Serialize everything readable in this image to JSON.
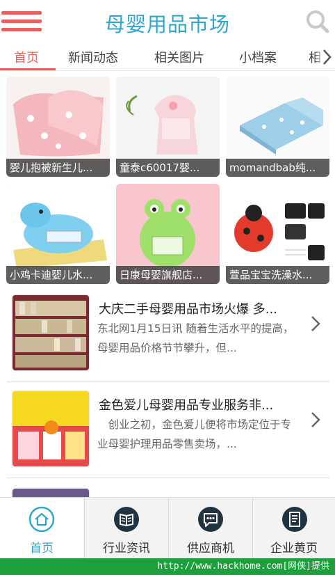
{
  "header": {
    "title": "母婴用品市场",
    "menu_icon": "hamburger-menu-icon",
    "search_icon": "search-icon"
  },
  "tabs": [
    {
      "label": "首页",
      "active": true
    },
    {
      "label": "新闻动态",
      "active": false
    },
    {
      "label": "相关图片",
      "active": false
    },
    {
      "label": "小档案",
      "active": false
    },
    {
      "label": "相",
      "active": false
    }
  ],
  "gallery": [
    {
      "caption": "婴儿抱被新生儿..."
    },
    {
      "caption": "童泰c60017婴..."
    },
    {
      "caption": "momandbab纯..."
    },
    {
      "caption": "小鸡卡迪婴儿水..."
    },
    {
      "caption": "日康母婴旗舰店..."
    },
    {
      "caption": "萱品宝宝洗澡水..."
    }
  ],
  "news": [
    {
      "title": "大庆二手母婴用品市场火爆 多...",
      "summary": "东北网1月15日讯 随着生活水平的提高，母婴用品价格节节攀升，但..."
    },
    {
      "title": "金色爱儿母婴用品专业服务非...",
      "summary": "　创业之初，金色爱儿便将市场定位于专业母婴护理用品零售卖场，..."
    }
  ],
  "bottom_nav": [
    {
      "label": "首页",
      "icon": "home-icon",
      "active": true
    },
    {
      "label": "行业资讯",
      "icon": "book-icon",
      "active": false
    },
    {
      "label": "供应商机",
      "icon": "chat-icon",
      "active": false
    },
    {
      "label": "企业黄页",
      "icon": "document-icon",
      "active": false
    }
  ],
  "watermark": "http://www.hackhome.com[网侠]提供",
  "colors": {
    "accent_red": "#e8605f",
    "title_blue": "#2fa6cf",
    "nav_dark": "#1f3340",
    "watermark_green": "#1d9f3b"
  }
}
